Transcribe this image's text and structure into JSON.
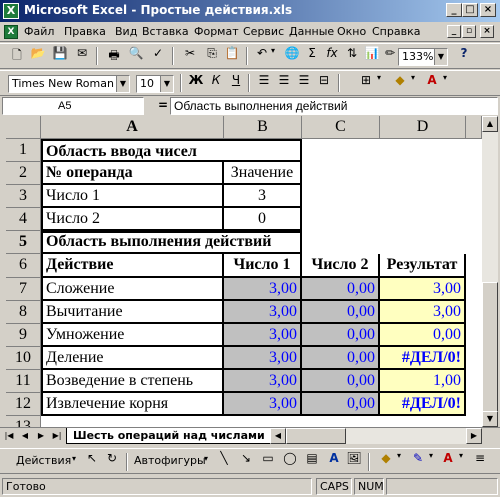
{
  "window": {
    "title": "Microsoft Excel - Простые действия.xls",
    "app_icon": "X"
  },
  "menu": [
    "Файл",
    "Правка",
    "Вид",
    "Вставка",
    "Формат",
    "Сервис",
    "Данные",
    "Окно",
    "Справка"
  ],
  "toolbar": {
    "zoom": "133%",
    "font": "Times New Roman Cyr",
    "font_size": "10",
    "bold": "Ж",
    "italic": "К",
    "underline": "Ч",
    "autosum": "Σ",
    "function": "fx",
    "question": "?"
  },
  "formula_bar": {
    "cell_ref": "A5",
    "equals": "=",
    "content": "Область выполнения действий"
  },
  "columns": [
    "A",
    "B",
    "C",
    "D"
  ],
  "rows": [
    "1",
    "2",
    "3",
    "4",
    "5",
    "6",
    "7",
    "8",
    "9",
    "10",
    "11",
    "12",
    "13"
  ],
  "cells": {
    "A1": "Область ввода чисел",
    "A2": "№ операнда",
    "B2": "Значение",
    "A3": "Число 1",
    "B3": "3",
    "A4": "Число 2",
    "B4": "0",
    "A5": "Область выполнения действий",
    "A6": "Действие",
    "B6": "Число 1",
    "C6": "Число 2",
    "D6": "Результат",
    "A7": "Сложение",
    "B7": "3,00",
    "C7": "0,00",
    "D7": "3,00",
    "A8": "Вычитание",
    "B8": "3,00",
    "C8": "0,00",
    "D8": "3,00",
    "A9": "Умножение",
    "B9": "3,00",
    "C9": "0,00",
    "D9": "0,00",
    "A10": "Деление",
    "B10": "3,00",
    "C10": "0,00",
    "D10": "#ДЕЛ/0!",
    "A11": "Возведение в степень",
    "B11": "3,00",
    "C11": "0,00",
    "D11": "1,00",
    "A12": "Извлечение корня",
    "B12": "3,00",
    "C12": "0,00",
    "D12": "#ДЕЛ/0!"
  },
  "sheet_tab": "Шесть операций над числами",
  "drawing": {
    "actions": "Действия",
    "autoshapes": "Автофигуры"
  },
  "status": {
    "ready": "Готово",
    "caps": "CAPS",
    "num": "NUM"
  },
  "colors": {
    "title_bar": "#0a246a",
    "gray_fill": "#c0c0c0",
    "yellow_fill": "#ffffc0",
    "number_blue": "#0000ff"
  }
}
